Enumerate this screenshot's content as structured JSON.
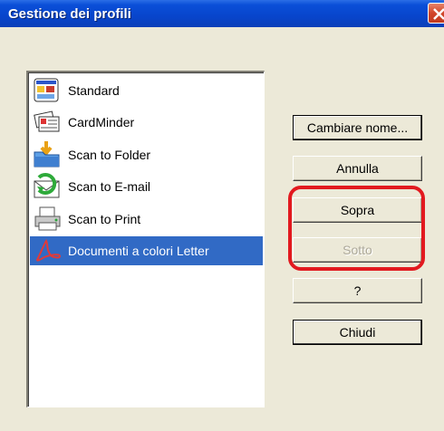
{
  "window": {
    "title": "Gestione dei profili",
    "colors": {
      "titlebar": "#0845cc",
      "selection": "#316ac5",
      "highlight_ring": "#e2191f",
      "face": "#ece9d8"
    }
  },
  "profiles": [
    {
      "label": "Standard",
      "icon": "standard-profile-icon",
      "selected": false
    },
    {
      "label": "CardMinder",
      "icon": "cardminder-icon",
      "selected": false
    },
    {
      "label": "Scan to Folder",
      "icon": "folder-icon",
      "selected": false
    },
    {
      "label": "Scan to E-mail",
      "icon": "email-icon",
      "selected": false
    },
    {
      "label": "Scan to Print",
      "icon": "printer-icon",
      "selected": false
    },
    {
      "label": "Documenti a colori Letter",
      "icon": "pdf-icon",
      "selected": true
    }
  ],
  "buttons": {
    "rename": "Cambiare nome...",
    "cancel": "Annulla",
    "up": "Sopra",
    "down": "Sotto",
    "help": "?",
    "close": "Chiudi"
  },
  "states": {
    "down_disabled": true
  }
}
